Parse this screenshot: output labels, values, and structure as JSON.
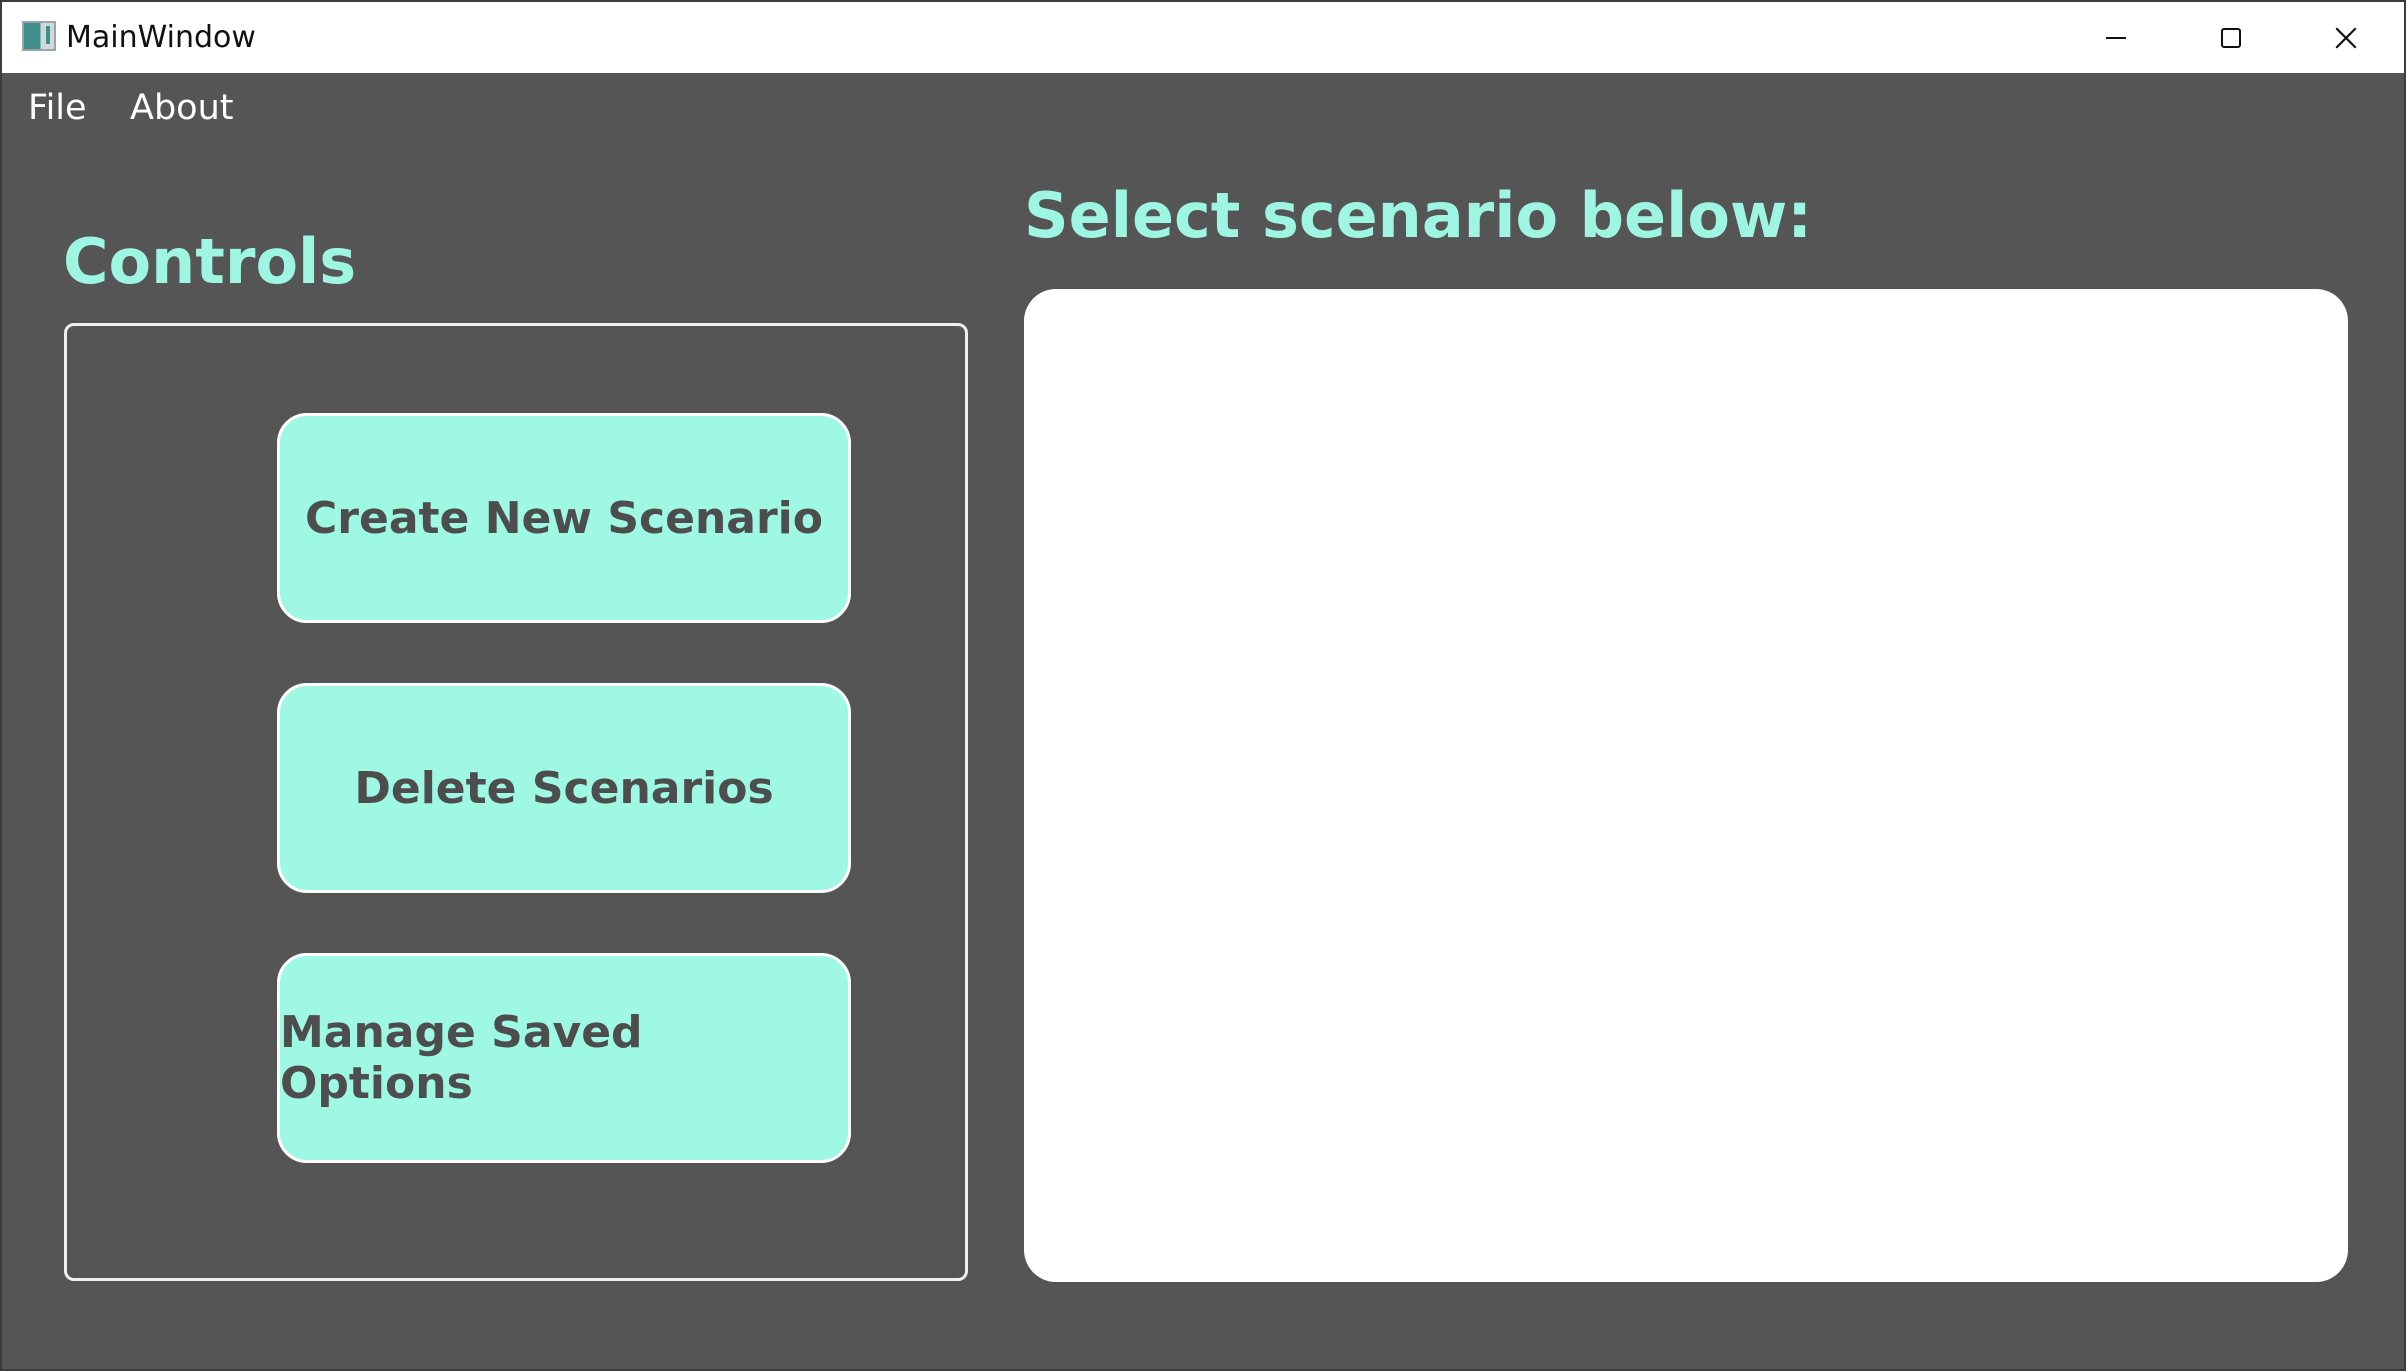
{
  "window": {
    "title": "MainWindow",
    "controls": {
      "minimize_icon": "minimize-icon",
      "maximize_icon": "maximize-icon",
      "close_icon": "close-icon"
    }
  },
  "menu": {
    "items": [
      {
        "label": "File"
      },
      {
        "label": "About"
      }
    ]
  },
  "controls": {
    "heading": "Controls",
    "buttons": [
      {
        "label": "Create New Scenario"
      },
      {
        "label": "Delete Scenarios"
      },
      {
        "label": "Manage Saved Options"
      }
    ]
  },
  "scenarios": {
    "heading": "Select scenario below:",
    "items": []
  },
  "colors": {
    "background": "#555555",
    "accent": "#9ef6e2",
    "button_text": "#4d4d4d",
    "list_background": "#ffffff"
  }
}
